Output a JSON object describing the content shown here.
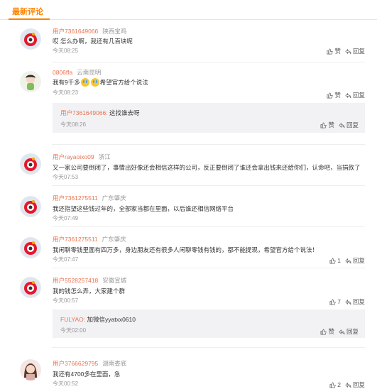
{
  "header": {
    "title": "最新评论"
  },
  "labels": {
    "like": "赞",
    "reply": "回复"
  },
  "colors": {
    "accent": "#ff8200",
    "username": "#eb7350"
  },
  "comments": [
    {
      "user": "用户7361649066",
      "location": "陕西宝鸡",
      "text": "哎 怎么办啊，我还有几百块呢",
      "time": "今天08:25",
      "likes": ""
    },
    {
      "user": "0806ffa",
      "location": "云南昆明",
      "text_before": "我有9千多",
      "text_after": "希望官方给个说法",
      "emoji": [
        "流泪",
        "流泪"
      ],
      "time": "今天08:23",
      "likes": "",
      "reply": {
        "user": "用户7361649066:",
        "text": "这找谁去呀",
        "time": "今天08:26",
        "likes": ""
      }
    },
    {
      "user": "用户rayaoixo09",
      "location": "浙江",
      "text": "又一家公司要倒闭了，事情出好像还会相信这样的公司，反正要倒闭了谁还会拿出钱来还给你们，认命吧，当捐款了",
      "time": "今天07:53",
      "likes": ""
    },
    {
      "user": "用户7361275511",
      "location": "广东肇庆",
      "text": "我还指望这些钱过年的，全部家当都在里面，以后谁还相信网络平台",
      "time": "今天07:49",
      "likes": ""
    },
    {
      "user": "用户7361275511",
      "location": "广东肇庆",
      "text": "我闲聊零钱里面有四万多，身边朋友还有很多人闲聊零钱有钱的，都不能提现，希望官方给个说法！",
      "time": "今天07:47",
      "likes": "1"
    },
    {
      "user": "用户5528257418",
      "location": "安徽宣城",
      "text": "我的钱怎么弄，大家建个群",
      "time": "今天00:57",
      "likes": "7",
      "reply": {
        "user": "FULYAO:",
        "text": "加微信yyatxx0610",
        "time": "今天02:00",
        "likes": ""
      }
    },
    {
      "user": "用户3766629795",
      "location": "湖南娄底",
      "text": "我还有4700多在里面，急",
      "time": "今天00:52",
      "likes": "2"
    }
  ]
}
